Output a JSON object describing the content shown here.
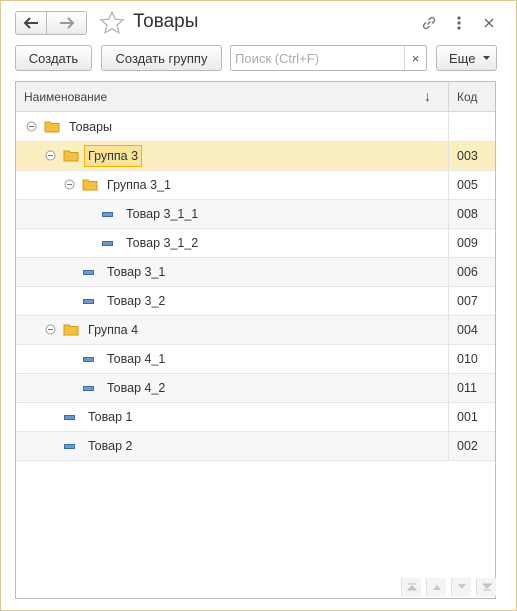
{
  "window": {
    "title": "Товары"
  },
  "toolbar": {
    "create_label": "Создать",
    "create_group_label": "Создать группу",
    "search_placeholder": "Поиск (Ctrl+F)",
    "search_clear": "×",
    "more_label": "Еще"
  },
  "table": {
    "col_name": "Наименование",
    "col_code": "Код",
    "sort_indicator": "↓",
    "rows": [
      {
        "label": "Товары",
        "code": "",
        "type": "folder",
        "expanded": true
      },
      {
        "label": "Группа 3",
        "code": "003",
        "type": "folder",
        "expanded": true,
        "selected": true
      },
      {
        "label": "Группа 3_1",
        "code": "005",
        "type": "folder",
        "expanded": true
      },
      {
        "label": "Товар 3_1_1",
        "code": "008",
        "type": "item"
      },
      {
        "label": "Товар 3_1_2",
        "code": "009",
        "type": "item"
      },
      {
        "label": "Товар 3_1",
        "code": "006",
        "type": "item"
      },
      {
        "label": "Товар 3_2",
        "code": "007",
        "type": "item"
      },
      {
        "label": "Группа 4",
        "code": "004",
        "type": "folder",
        "expanded": true
      },
      {
        "label": "Товар 4_1",
        "code": "010",
        "type": "item"
      },
      {
        "label": "Товар 4_2",
        "code": "011",
        "type": "item"
      },
      {
        "label": "Товар 1",
        "code": "001",
        "type": "item"
      },
      {
        "label": "Товар 2",
        "code": "002",
        "type": "item"
      }
    ]
  },
  "icons": {
    "back": "arrow-left-icon",
    "forward": "arrow-right-icon",
    "favorite": "star-icon",
    "link": "link-icon",
    "menu": "more-vertical-icon",
    "close": "close-icon",
    "dropdown": "caret-down-icon",
    "folder": "folder-icon",
    "item": "item-icon",
    "collapse": "collapse-icon",
    "pager_first": "page-first-icon",
    "pager_up": "page-up-icon",
    "pager_down": "page-down-icon",
    "pager_last": "page-last-icon"
  },
  "colors": {
    "selection_row": "#fbeec1",
    "selection_cell": "#fbe39a",
    "selection_border": "#f0b400",
    "folder": "#f3c042",
    "item": "#4a7fb5"
  }
}
